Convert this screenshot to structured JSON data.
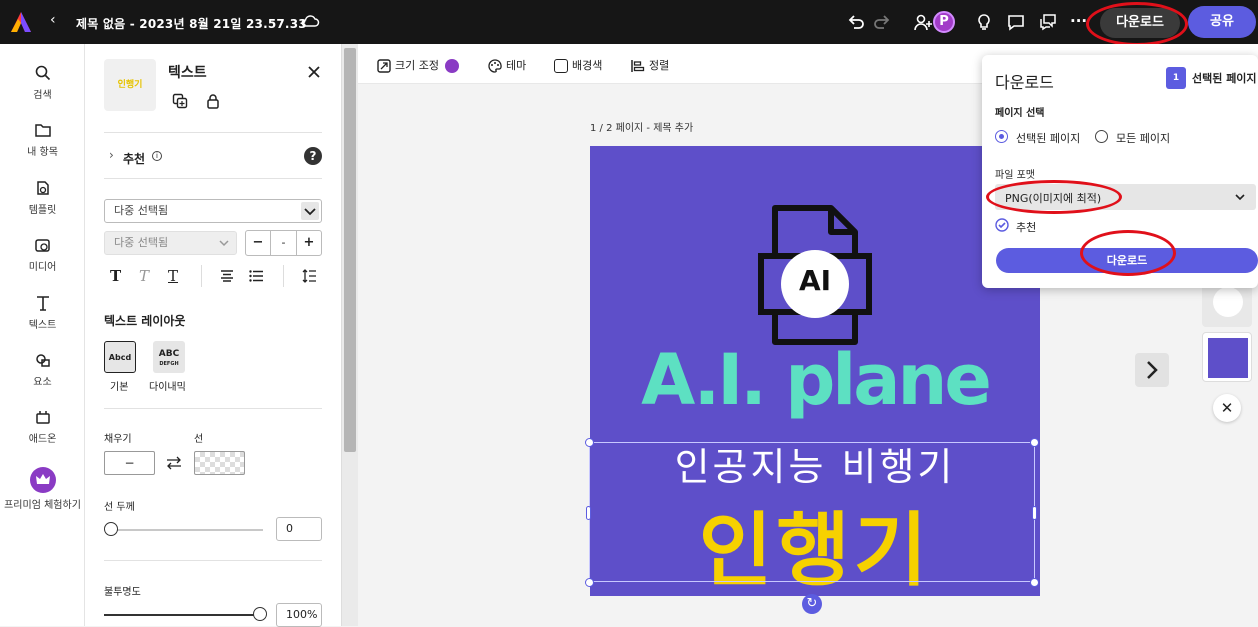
{
  "topbar": {
    "back_icon": "chevron-left-icon",
    "title": "제목 없음 - 2023년 8월 21일 23.57.33",
    "download_label": "다운로드",
    "share_label": "공유",
    "avatar_letter": "P"
  },
  "leftnav": {
    "items": [
      {
        "label": "검색",
        "icon": "search-icon"
      },
      {
        "label": "내 항목",
        "icon": "folder-icon"
      },
      {
        "label": "템플릿",
        "icon": "template-icon"
      },
      {
        "label": "미디어",
        "icon": "media-icon"
      },
      {
        "label": "텍스트",
        "icon": "text-icon"
      },
      {
        "label": "요소",
        "icon": "shapes-icon"
      },
      {
        "label": "애드온",
        "icon": "addon-icon"
      },
      {
        "label": "프리미엄 체험하기",
        "icon": "crown-icon"
      }
    ]
  },
  "panel": {
    "thumb_text": "인행기",
    "title": "텍스트",
    "recommend_label": "추천",
    "font_select": "다중 선택됨",
    "size_select": "다중 선택됨",
    "stepper_minus": "−",
    "stepper_value": "-",
    "stepper_plus": "+",
    "layout_title": "텍스트 레이아웃",
    "layout_basic_preview": "Abcd",
    "layout_basic_label": "기본",
    "layout_dynamic_preview_top": "ABC",
    "layout_dynamic_preview_bottom": "DEFGH",
    "layout_dynamic_label": "다이내믹",
    "fill_label": "채우기",
    "stroke_label": "선",
    "fill_value": "−",
    "stroke_width_label": "선 두께",
    "stroke_width_value": "0",
    "opacity_label": "불투명도",
    "opacity_value": "100%",
    "stroke_width_level": 0,
    "opacity_level": 1.0
  },
  "toolbar2": {
    "resize_label": "크기 조정",
    "theme_label": "테마",
    "bg_label": "배경색",
    "align_label": "정렬"
  },
  "canvas": {
    "page_label": "1 / 2 페이지 - 제목 추가",
    "ai_badge": "AI",
    "title_en": "A.I. plane",
    "subtitle_ko": "인공지능 비행기",
    "big_ko": "인행기",
    "bg_color": "#5e4fc9"
  },
  "download_panel": {
    "title": "다운로드",
    "page_badge": "1",
    "selected_page_label": "선택된 페이지",
    "page_select_label": "페이지 선택",
    "radio_selected": "선택된 페이지",
    "radio_all": "모든 페이지",
    "format_label": "파일 포맷",
    "format_value": "PNG(이미지에 최적)",
    "recommend_label": "추천",
    "download_button": "다운로드"
  }
}
